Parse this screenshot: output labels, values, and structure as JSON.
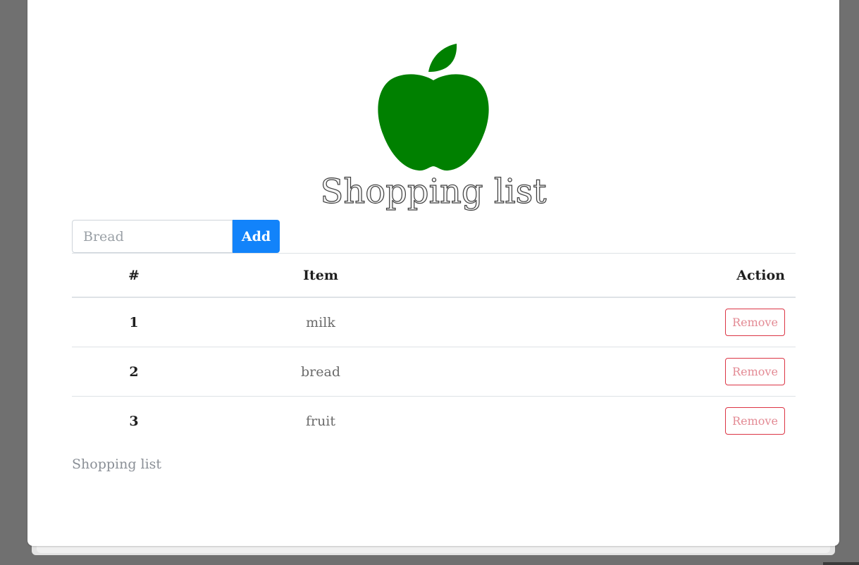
{
  "app": {
    "title": "Shopping list"
  },
  "form": {
    "input_placeholder": "Bread",
    "input_value": "",
    "add_label": "Add"
  },
  "table": {
    "headers": [
      "#",
      "Item",
      "Action"
    ],
    "rows": [
      {
        "num": "1",
        "item": "milk",
        "action": "Remove"
      },
      {
        "num": "2",
        "item": "bread",
        "action": "Remove"
      },
      {
        "num": "3",
        "item": "fruit",
        "action": "Remove"
      }
    ]
  },
  "footer": {
    "text": "Shopping list"
  },
  "colors": {
    "logo": "#008000",
    "add_button": "#1283fa",
    "remove_border": "#dc3545",
    "background": "#707070"
  },
  "icons": {
    "logo": "apple-icon"
  }
}
